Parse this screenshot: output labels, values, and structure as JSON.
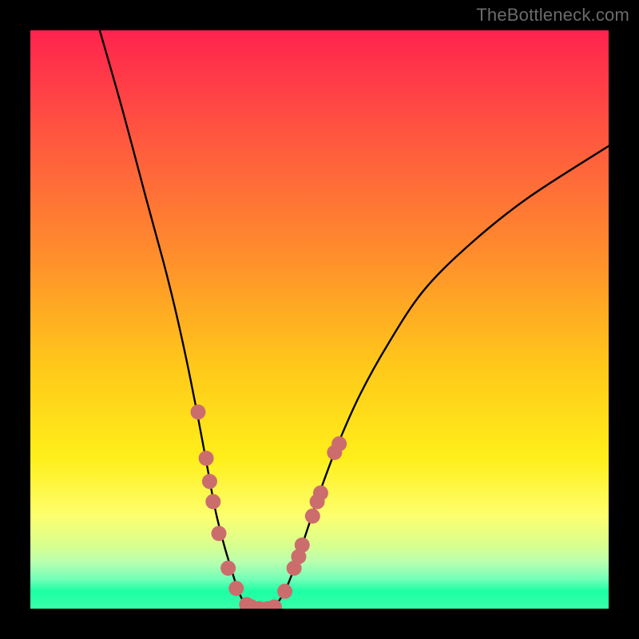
{
  "watermark": "TheBottleneck.com",
  "chart_data": {
    "type": "line",
    "title": "",
    "xlabel": "",
    "ylabel": "",
    "xlim": [
      0,
      100
    ],
    "ylim": [
      0,
      100
    ],
    "grid": false,
    "legend": false,
    "series": [
      {
        "name": "curve-left",
        "x": [
          12,
          16,
          20,
          23,
          25,
          27,
          29,
          30.5,
          32,
          33.5,
          35,
          36,
          37,
          38
        ],
        "values": [
          100,
          86,
          71,
          60,
          52,
          43,
          33,
          25,
          17,
          11,
          6,
          3,
          1,
          0
        ]
      },
      {
        "name": "curve-right",
        "x": [
          42,
          44,
          46,
          48,
          50,
          53,
          57,
          62,
          68,
          76,
          86,
          100
        ],
        "values": [
          0,
          3,
          8,
          14,
          20,
          28,
          37,
          46,
          55,
          63,
          71,
          80
        ]
      }
    ],
    "markers": {
      "name": "highlight-dots",
      "color": "#cc6d6d",
      "points": [
        {
          "x": 29.0,
          "y": 34.0
        },
        {
          "x": 30.4,
          "y": 26.0
        },
        {
          "x": 31.0,
          "y": 22.0
        },
        {
          "x": 31.6,
          "y": 18.5
        },
        {
          "x": 32.6,
          "y": 13.0
        },
        {
          "x": 34.2,
          "y": 7.0
        },
        {
          "x": 35.6,
          "y": 3.5
        },
        {
          "x": 37.4,
          "y": 0.7
        },
        {
          "x": 38.2,
          "y": 0.3
        },
        {
          "x": 39.6,
          "y": 0.0
        },
        {
          "x": 41.0,
          "y": 0.0
        },
        {
          "x": 42.2,
          "y": 0.3
        },
        {
          "x": 44.0,
          "y": 3.0
        },
        {
          "x": 45.6,
          "y": 7.0
        },
        {
          "x": 46.4,
          "y": 9.0
        },
        {
          "x": 47.0,
          "y": 11.0
        },
        {
          "x": 48.8,
          "y": 16.0
        },
        {
          "x": 49.6,
          "y": 18.5
        },
        {
          "x": 50.2,
          "y": 20.0
        },
        {
          "x": 52.6,
          "y": 27.0
        },
        {
          "x": 53.4,
          "y": 28.5
        }
      ]
    }
  }
}
